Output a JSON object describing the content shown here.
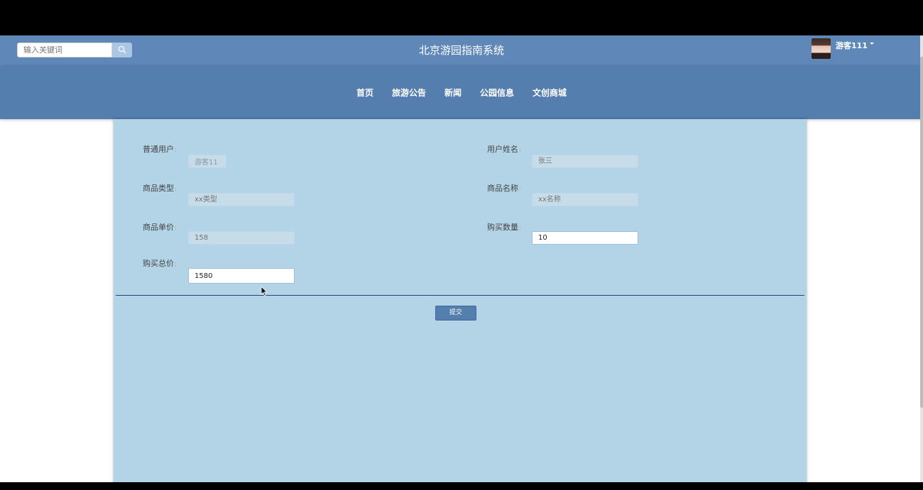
{
  "header": {
    "search_placeholder": "输入关键词",
    "site_title": "北京游园指南系统",
    "username": "游客111"
  },
  "nav": {
    "items": [
      "首页",
      "旅游公告",
      "新闻",
      "公园信息",
      "文创商城"
    ]
  },
  "form": {
    "user_label": "普通用户",
    "user_value": "游客11",
    "name_label": "用户姓名",
    "name_placeholder": "张三",
    "type_label": "商品类型",
    "type_placeholder": "xx类型",
    "product_label": "商品名称",
    "product_placeholder": "xx名称",
    "price_label": "商品单价",
    "price_placeholder": "158",
    "quantity_label": "购买数量",
    "quantity_value": "10",
    "total_label": "购买总价",
    "total_value": "1580",
    "submit_label": "提交"
  },
  "colors": {
    "topbar": "#5f87b8",
    "navbar": "#537eae",
    "content_bg": "#b3d4e7",
    "divider": "#2e3d7a"
  }
}
